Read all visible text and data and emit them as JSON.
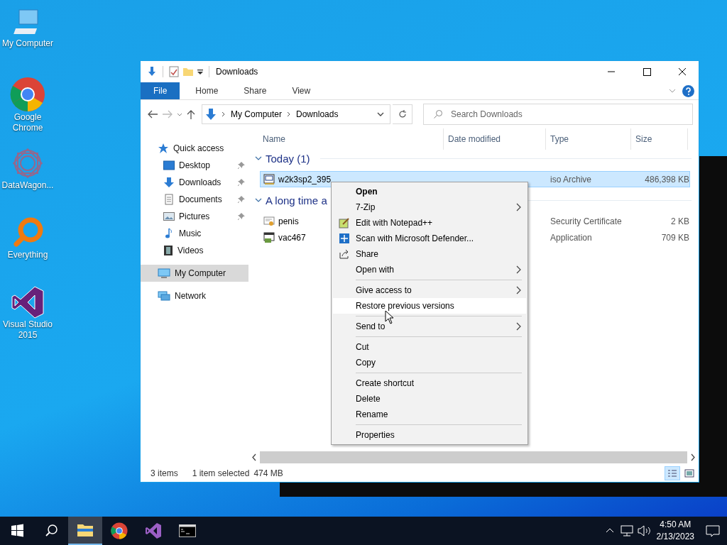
{
  "desktop_icons": [
    {
      "label": "My Computer",
      "kind": "computer"
    },
    {
      "label": "Google Chrome",
      "kind": "chrome"
    },
    {
      "label": "DataWagon...",
      "kind": "wagon"
    },
    {
      "label": "Everything",
      "kind": "everything"
    },
    {
      "label": "Visual Studio 2015",
      "kind": "vs"
    }
  ],
  "window": {
    "title": "Downloads",
    "ribbon_tabs": [
      {
        "label": "File",
        "selected": true
      },
      {
        "label": "Home",
        "selected": false
      },
      {
        "label": "Share",
        "selected": false
      },
      {
        "label": "View",
        "selected": false
      }
    ],
    "address": [
      "My Computer",
      "Downloads"
    ],
    "search": {
      "placeholder": "Search Downloads"
    },
    "sidebar": {
      "items": [
        {
          "label": "Quick access",
          "kind": "star",
          "selected": false,
          "children": [
            {
              "label": "Desktop",
              "kind": "desktop",
              "pinned": true,
              "selected": false
            },
            {
              "label": "Downloads",
              "kind": "download",
              "pinned": true,
              "selected": false
            },
            {
              "label": "Documents",
              "kind": "document",
              "pinned": true,
              "selected": false
            },
            {
              "label": "Pictures",
              "kind": "pictures",
              "pinned": true,
              "selected": false
            },
            {
              "label": "Music",
              "kind": "music",
              "pinned": false,
              "selected": false
            },
            {
              "label": "Videos",
              "kind": "videos",
              "pinned": false,
              "selected": false
            }
          ]
        },
        {
          "label": "My Computer",
          "kind": "computer",
          "selected": true
        },
        {
          "label": "Network",
          "kind": "network",
          "selected": false
        }
      ]
    },
    "table": {
      "columns": [
        "Name",
        "Date modified",
        "Type",
        "Size"
      ],
      "groups": [
        {
          "label": "Today (1)",
          "rows": [
            {
              "name": "w2k3sp2_395",
              "kind": "iso",
              "type": "iso Archive",
              "size": "486,398 KB",
              "selected": true
            }
          ]
        },
        {
          "label": "A long time a",
          "rows": [
            {
              "name": "penis",
              "kind": "cert",
              "type": "Security Certificate",
              "size": "2 KB",
              "selected": false
            },
            {
              "name": "vac467",
              "kind": "app",
              "type": "Application",
              "size": "709 KB",
              "selected": false
            }
          ]
        }
      ]
    },
    "status_bar": {
      "count": "3 items",
      "selection": "1 item selected",
      "size": "474 MB"
    },
    "views": [
      {
        "kind": "details",
        "selected": true
      },
      {
        "kind": "large",
        "selected": false
      }
    ]
  },
  "context_menu": [
    {
      "kind": "item",
      "label": "Open",
      "bold": true,
      "submenu": false,
      "highlighted": false
    },
    {
      "kind": "item",
      "label": "7-Zip",
      "bold": false,
      "submenu": true,
      "highlighted": false
    },
    {
      "kind": "edit",
      "label": "Edit with Notepad++",
      "bold": false,
      "submenu": false,
      "highlighted": false
    },
    {
      "kind": "scan",
      "label": "Scan with Microsoft Defender...",
      "bold": false,
      "submenu": false,
      "highlighted": false
    },
    {
      "kind": "share",
      "label": "Share",
      "bold": false,
      "submenu": false,
      "highlighted": false
    },
    {
      "kind": "item",
      "label": "Open with",
      "bold": false,
      "submenu": true,
      "highlighted": false
    },
    {
      "kind": "separator"
    },
    {
      "kind": "item",
      "label": "Give access to",
      "bold": false,
      "submenu": true,
      "highlighted": false
    },
    {
      "kind": "item",
      "label": "Restore previous versions",
      "bold": false,
      "submenu": false,
      "highlighted": true
    },
    {
      "kind": "separator"
    },
    {
      "kind": "item",
      "label": "Send to",
      "bold": false,
      "submenu": true,
      "highlighted": false
    },
    {
      "kind": "separator"
    },
    {
      "kind": "item",
      "label": "Cut",
      "bold": false,
      "submenu": false,
      "highlighted": false
    },
    {
      "kind": "item",
      "label": "Copy",
      "bold": false,
      "submenu": false,
      "highlighted": false
    },
    {
      "kind": "separator"
    },
    {
      "kind": "item",
      "label": "Create shortcut",
      "bold": false,
      "submenu": false,
      "highlighted": false
    },
    {
      "kind": "item",
      "label": "Delete",
      "bold": false,
      "submenu": false,
      "highlighted": false
    },
    {
      "kind": "item",
      "label": "Rename",
      "bold": false,
      "submenu": false,
      "highlighted": false
    },
    {
      "kind": "separator"
    },
    {
      "kind": "item",
      "label": "Properties",
      "bold": false,
      "submenu": false,
      "highlighted": false
    }
  ],
  "taskbar": {
    "apps": [
      {
        "kind": "explorer",
        "active": true
      },
      {
        "kind": "chrome",
        "active": false
      },
      {
        "kind": "vs",
        "active": false
      },
      {
        "kind": "console",
        "active": false
      }
    ],
    "time": "4:50 AM",
    "date": "2/13/2023"
  }
}
